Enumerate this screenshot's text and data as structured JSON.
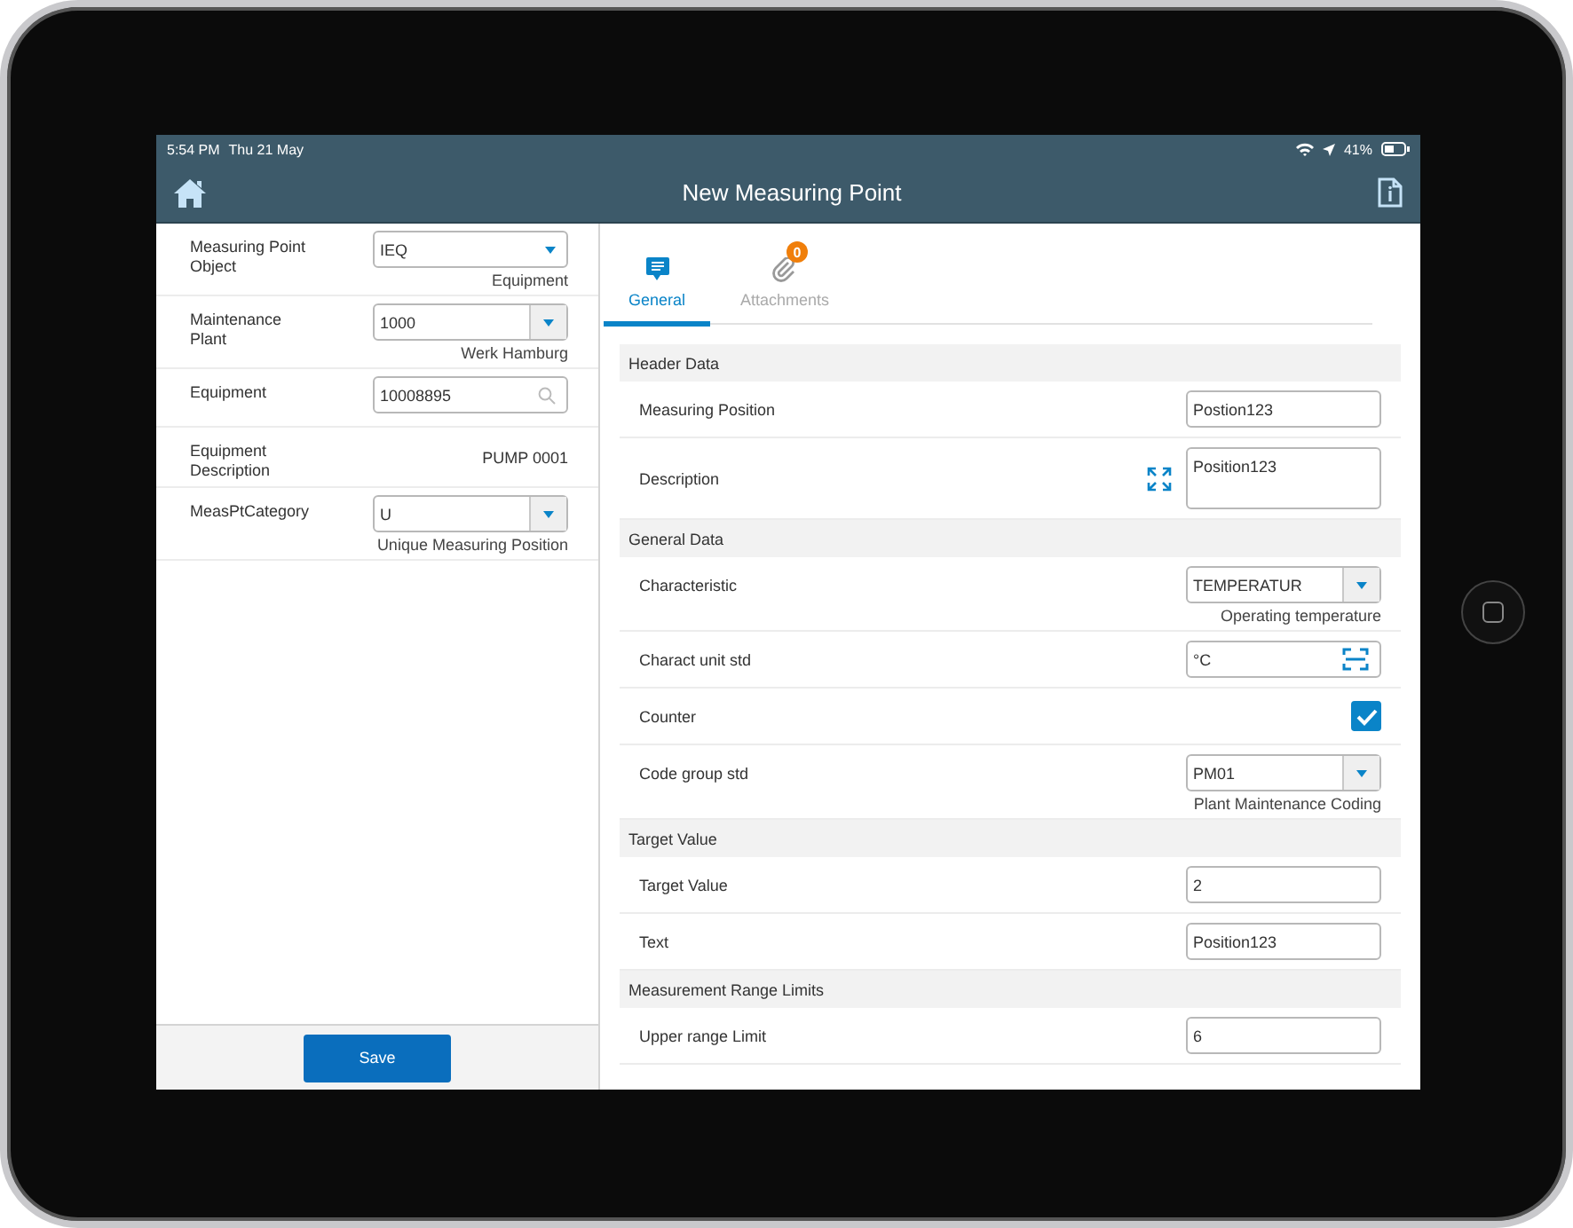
{
  "status_bar": {
    "time": "5:54 PM",
    "date": "Thu 21 May",
    "battery": "41%"
  },
  "nav": {
    "title": "New Measuring Point"
  },
  "left_fields": [
    {
      "label": "Measuring Point Object",
      "kind": "picker",
      "value": "IEQ",
      "caption": "Equipment"
    },
    {
      "label": "Maintenance Plant",
      "kind": "dropdown",
      "value": "1000",
      "caption": "Werk Hamburg"
    },
    {
      "label": "Equipment",
      "kind": "search",
      "value": "10008895"
    },
    {
      "label": "Equipment Description",
      "kind": "text",
      "value": "PUMP 0001"
    },
    {
      "label": "MeasPtCategory",
      "kind": "dropdown",
      "value": "U",
      "caption": "Unique Measuring Position"
    }
  ],
  "save_button": "Save",
  "tabs": [
    {
      "label": "General",
      "selected": true,
      "kind": "general"
    },
    {
      "label": "Attachments",
      "selected": false,
      "kind": "attachments",
      "badge": "0"
    }
  ],
  "sections": [
    {
      "title": "Header Data",
      "rows": [
        {
          "label": "Measuring Position",
          "kind": "input",
          "value": "Postion123"
        },
        {
          "label": "Description",
          "kind": "textarea",
          "value": "Position123"
        }
      ]
    },
    {
      "title": "General Data",
      "rows": [
        {
          "label": "Characteristic",
          "kind": "dropdown",
          "value": "TEMPERATUR",
          "caption": "Operating temperature"
        },
        {
          "label": "Charact unit std",
          "kind": "scan",
          "value": "°C"
        },
        {
          "label": "Counter",
          "kind": "checkbox",
          "checked": true
        },
        {
          "label": "Code group std",
          "kind": "dropdown",
          "value": "PM01",
          "caption": "Plant Maintenance Coding"
        }
      ]
    },
    {
      "title": "Target Value",
      "rows": [
        {
          "label": "Target Value",
          "kind": "input",
          "value": "2"
        },
        {
          "label": "Text",
          "kind": "input",
          "value": "Position123"
        }
      ]
    },
    {
      "title": "Measurement Range Limits",
      "rows": [
        {
          "label": "Upper range Limit",
          "kind": "input",
          "value": "6"
        }
      ]
    }
  ]
}
